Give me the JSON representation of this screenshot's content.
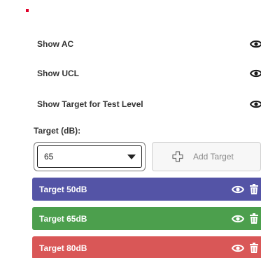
{
  "colors": {
    "marker": "#e0002a",
    "target_50": "#5454a6",
    "target_65": "#4c9f4d",
    "target_80": "#d95757"
  },
  "toggles": [
    {
      "label": "Show AC",
      "icon": "eye-icon"
    },
    {
      "label": "Show UCL",
      "icon": "eye-icon"
    },
    {
      "label": "Show Target for Test Level",
      "icon": "eye-icon"
    }
  ],
  "target_section": {
    "title": "Target (dB):",
    "selected_value": "65",
    "add_button_label": "Add Target",
    "add_icon": "plus-outline-icon"
  },
  "targets": [
    {
      "label": "Target 50dB",
      "icons": [
        "eye-icon",
        "trash-icon"
      ]
    },
    {
      "label": "Target 65dB",
      "icons": [
        "eye-icon",
        "trash-icon"
      ]
    },
    {
      "label": "Target 80dB",
      "icons": [
        "eye-icon",
        "trash-icon"
      ]
    }
  ]
}
